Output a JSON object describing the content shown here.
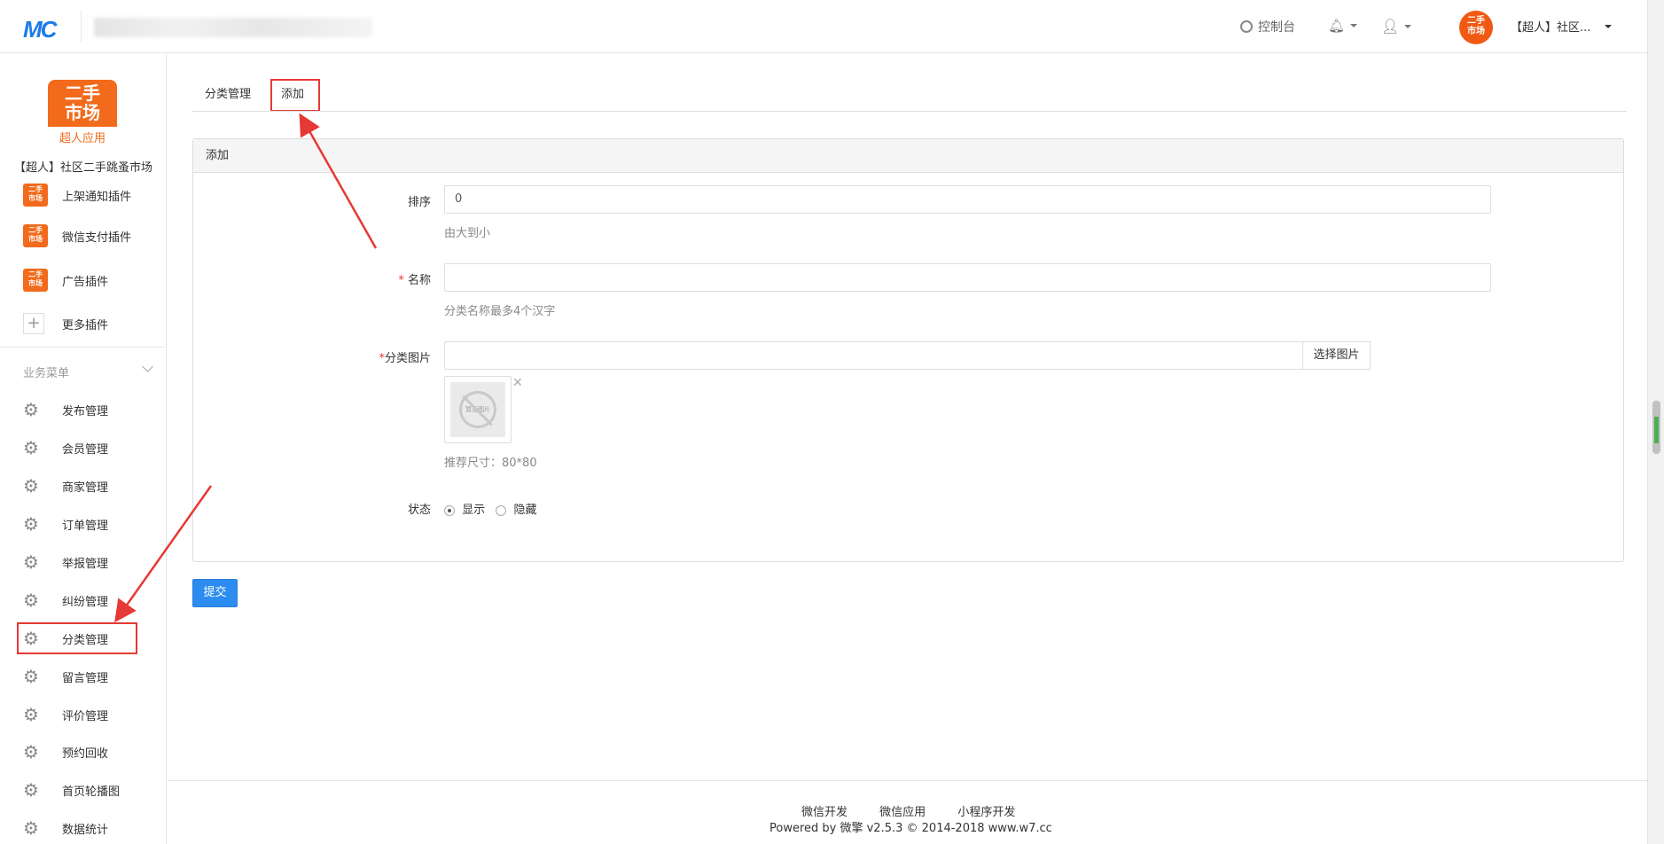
{
  "header": {
    "logo_text": "MC",
    "console_label": "控制台",
    "account_label": "【超人】社区...",
    "avatar_text": "二手\n市场"
  },
  "sidebar": {
    "app_logo_main": "二手\n市场",
    "app_logo_sub": "超人应用",
    "app_name": "【超人】社区二手跳蚤市场",
    "plugins": [
      {
        "label": "上架通知插件"
      },
      {
        "label": "微信支付插件"
      },
      {
        "label": "广告插件"
      },
      {
        "label": "更多插件"
      }
    ],
    "section_title": "业务菜单",
    "items": [
      {
        "label": "发布管理"
      },
      {
        "label": "会员管理"
      },
      {
        "label": "商家管理"
      },
      {
        "label": "订单管理"
      },
      {
        "label": "举报管理"
      },
      {
        "label": "纠纷管理"
      },
      {
        "label": "分类管理"
      },
      {
        "label": "留言管理"
      },
      {
        "label": "评价管理"
      },
      {
        "label": "预约回收"
      },
      {
        "label": "首页轮播图"
      },
      {
        "label": "数据统计"
      }
    ]
  },
  "tabs": [
    {
      "label": "分类管理"
    },
    {
      "label": "添加"
    }
  ],
  "panel": {
    "title": "添加",
    "sort": {
      "label": "排序",
      "value": "0",
      "help": "由大到小"
    },
    "name": {
      "label": "名称",
      "value": "",
      "help": "分类名称最多4个汉字"
    },
    "image": {
      "label": "分类图片",
      "value": "",
      "button": "选择图片",
      "placeholder_text": "暂无图片",
      "help": "推荐尺寸：80*80"
    },
    "status": {
      "label": "状态",
      "options": [
        "显示",
        "隐藏"
      ],
      "selected": "显示"
    }
  },
  "submit_label": "提交",
  "footer": {
    "links": [
      "微信开发",
      "微信应用",
      "小程序开发"
    ],
    "copyright": "Powered by 微擎 v2.5.3 © 2014-2018 www.w7.cc"
  }
}
